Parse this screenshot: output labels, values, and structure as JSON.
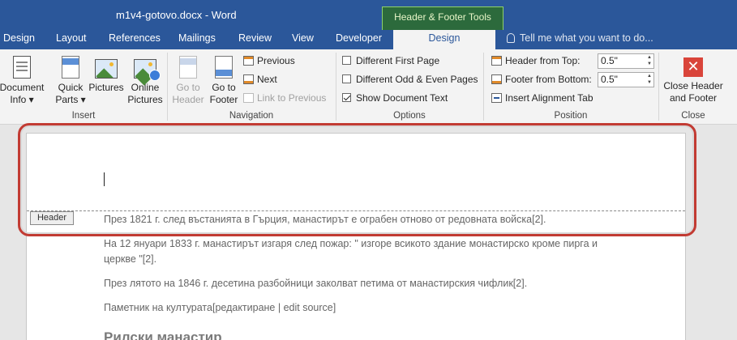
{
  "window": {
    "title": "m1v4-gotovo.docx - Word",
    "contextual_tab": "Header & Footer Tools"
  },
  "tabs": [
    {
      "label": "Design"
    },
    {
      "label": "Layout"
    },
    {
      "label": "References"
    },
    {
      "label": "Mailings"
    },
    {
      "label": "Review"
    },
    {
      "label": "View"
    },
    {
      "label": "Developer"
    },
    {
      "label": "Design"
    }
  ],
  "tell_me": "Tell me what you want to do...",
  "ribbon": {
    "insert": {
      "label": "Insert",
      "document_info": [
        "Document",
        "Info"
      ],
      "quick_parts": [
        "Quick",
        "Parts"
      ],
      "pictures": "Pictures",
      "online_pictures": [
        "Online",
        "Pictures"
      ]
    },
    "navigation": {
      "label": "Navigation",
      "go_to_header": [
        "Go to",
        "Header"
      ],
      "go_to_footer": [
        "Go to",
        "Footer"
      ],
      "previous": "Previous",
      "next": "Next",
      "link_to_previous": "Link to Previous"
    },
    "options": {
      "label": "Options",
      "different_first_page": "Different First Page",
      "different_odd_even": "Different Odd & Even Pages",
      "show_document_text": "Show Document Text",
      "show_document_text_checked": true
    },
    "position": {
      "label": "Position",
      "header_from_top": "Header from Top:",
      "header_from_top_value": "0.5\"",
      "footer_from_bottom": "Footer from Bottom:",
      "footer_from_bottom_value": "0.5\"",
      "insert_alignment_tab": "Insert Alignment Tab"
    },
    "close": {
      "label": "Close",
      "close_header_footer": [
        "Close Header",
        "and Footer"
      ]
    }
  },
  "document": {
    "header_tag": "Header",
    "paragraphs": [
      "През 1821 г. след въстанията в Гърция, манастирът е ограбен отново от редовната войска[2].",
      "На 12 януари 1833 г. манастирът изгаря след пожар: \" изгоре всикото здание монастирско кроме пирга и церкве \"[2].",
      "През лятото на 1846 г. десетина разбойници заколват петима от манастирския чифлик[2].",
      "Паметник на културата[редактиране | edit source]"
    ],
    "heading": "Рилски манастир"
  },
  "colors": {
    "accent": "#2b579a",
    "contextual": "#2c6a3c",
    "highlight": "#c23b33"
  }
}
